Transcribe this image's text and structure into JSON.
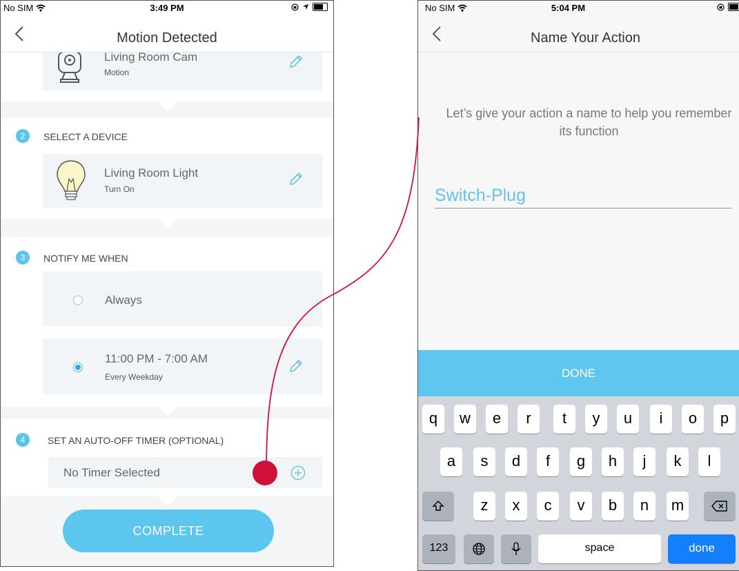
{
  "left_screen": {
    "status_bar": {
      "carrier": "No SIM",
      "time": "3:49 PM"
    },
    "nav_title": "Motion Detected",
    "camera_item": {
      "name": "Living Room Cam",
      "sub": "Motion"
    },
    "step2": {
      "number": "2",
      "title": "SELECT A DEVICE"
    },
    "device_item": {
      "name": "Living Room Light",
      "sub": "Turn On"
    },
    "step3": {
      "number": "3",
      "title": "NOTIFY ME WHEN"
    },
    "notify_options": [
      {
        "label": "Always",
        "sub": "",
        "selected": false
      },
      {
        "label": "11:00 PM - 7:00 AM",
        "sub": "Every Weekday",
        "selected": true
      }
    ],
    "step4": {
      "number": "4",
      "title": "SET AN AUTO-OFF TIMER (OPTIONAL)"
    },
    "timer": {
      "label": "No Timer Selected"
    },
    "complete_label": "COMPLETE"
  },
  "right_screen": {
    "status_bar": {
      "carrier": "No SIM",
      "time": "5:04 PM"
    },
    "nav_title": "Name Your Action",
    "prompt": "Let’s give your action a name to help you remember its function",
    "name_placeholder": "Switch-Plug",
    "done_bar_label": "DONE",
    "keyboard": {
      "row1": [
        "q",
        "w",
        "e",
        "r",
        "t",
        "y",
        "u",
        "i",
        "o",
        "p"
      ],
      "row2": [
        "a",
        "s",
        "d",
        "f",
        "g",
        "h",
        "j",
        "k",
        "l"
      ],
      "row3": [
        "z",
        "x",
        "c",
        "v",
        "b",
        "n",
        "m"
      ],
      "numbers_key": "123",
      "space_key": "space",
      "done_key": "done"
    }
  },
  "colors": {
    "accent": "#5cc6ee",
    "connector": "#d0103a",
    "keyboard_done": "#147efb"
  }
}
